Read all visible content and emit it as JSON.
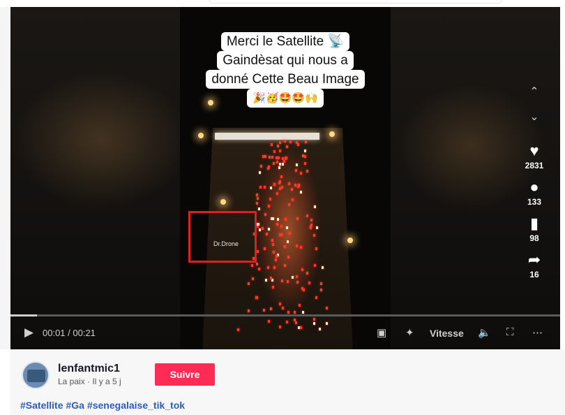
{
  "video": {
    "caption_lines": [
      "Merci le Satellite 📡",
      "Gaindèsat qui nous a",
      "donné Cette Beau Image",
      "🎉🥳🤩🤩🙌"
    ],
    "watermark": "Dr.Drone",
    "progress_fraction": 0.048
  },
  "actions": {
    "likes": "2831",
    "comments": "133",
    "saves": "98",
    "shares": "16"
  },
  "controls": {
    "time": "00:01 / 00:21",
    "speed_label": "Vitesse"
  },
  "author": {
    "username": "lenfantmic1",
    "meta": "La paix · Il y a 5 j",
    "follow_label": "Suivre"
  },
  "hashtags": [
    "#Satellite",
    "#Ga",
    "#senegalaise_tik_tok"
  ],
  "colors": {
    "follow": "#fe2c55",
    "hashtag": "#2b5db8",
    "highlight_box": "#e02020"
  }
}
